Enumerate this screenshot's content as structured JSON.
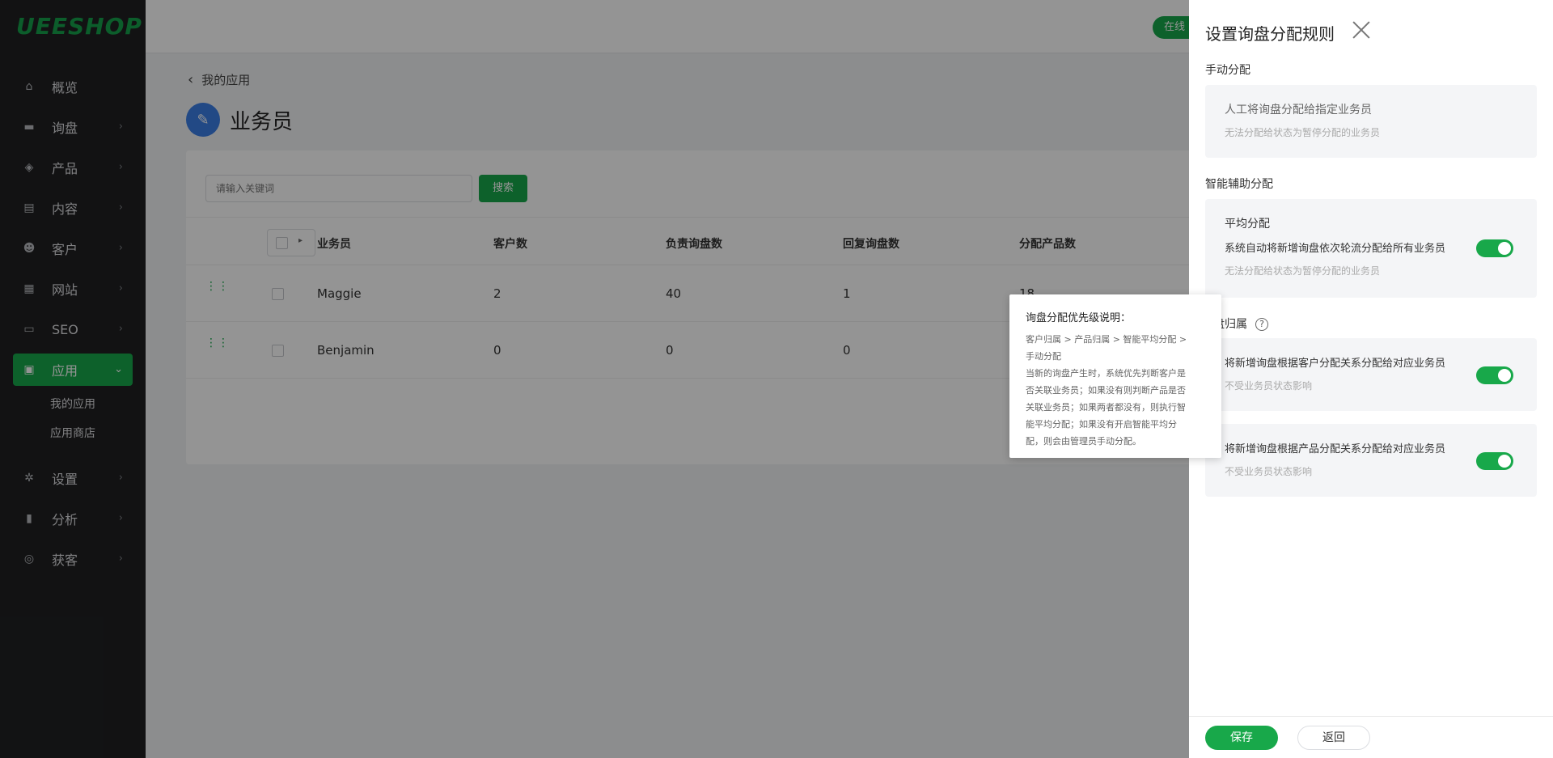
{
  "sidebar": {
    "logo": "UEESHOP",
    "items": [
      {
        "label": "概览",
        "icon": "home-icon"
      },
      {
        "label": "询盘",
        "icon": "inquiry-icon"
      },
      {
        "label": "产品",
        "icon": "product-box-icon"
      },
      {
        "label": "内容",
        "icon": "document-icon"
      },
      {
        "label": "客户",
        "icon": "customers-icon"
      },
      {
        "label": "网站",
        "icon": "store-icon"
      },
      {
        "label": "SEO",
        "icon": "seo-icon"
      },
      {
        "label": "应用",
        "icon": "apps-grid-icon"
      },
      {
        "label": "设置",
        "icon": "gear-icon"
      },
      {
        "label": "分析",
        "icon": "bar-chart-icon"
      },
      {
        "label": "获客",
        "icon": "acquire-icon"
      }
    ],
    "sub_items": [
      "我的应用",
      "应用商店"
    ]
  },
  "topbar": {
    "online_label": "在线"
  },
  "breadcrumb": {
    "back_label": "我的应用"
  },
  "page": {
    "title": "业务员"
  },
  "search": {
    "placeholder": "请输入关键词",
    "button_label": "搜索"
  },
  "table": {
    "columns": [
      "业务员",
      "客户数",
      "负责询盘数",
      "回复询盘数",
      "分配产品数"
    ],
    "rows": [
      {
        "name": "Maggie",
        "customers": "2",
        "inquiries": "40",
        "replied": "1",
        "products": "18"
      },
      {
        "name": "Benjamin",
        "customers": "0",
        "inquiries": "0",
        "replied": "0",
        "products": ""
      }
    ]
  },
  "drawer": {
    "title": "设置询盘分配规则",
    "manual": {
      "section": "手动分配",
      "title": "人工将询盘分配给指定业务员",
      "sub": "无法分配给状态为暂停分配的业务员"
    },
    "smart": {
      "section": "智能辅助分配",
      "title": "平均分配",
      "desc": "系统自动将新增询盘依次轮流分配给所有业务员",
      "sub": "无法分配给状态为暂停分配的业务员",
      "enabled": true
    },
    "ownership": {
      "section_visible": "盘归属",
      "help": "?",
      "customer_rule": {
        "title": "将新增询盘根据客户分配关系分配给对应业务员",
        "sub": "不受业务员状态影响",
        "enabled": true
      },
      "product_rule": {
        "title": "将新增询盘根据产品分配关系分配给对应业务员",
        "sub": "不受业务员状态影响",
        "enabled": true
      }
    },
    "save_label": "保存",
    "back_label": "返回"
  },
  "tooltip": {
    "title": "询盘分配优先级说明：",
    "lines": [
      "客户归属 > 产品归属 > 智能平均分配 >",
      "手动分配",
      "当新的询盘产生时，系统优先判断客户是",
      "否关联业务员；如果没有则判断产品是否",
      "关联业务员；如果两者都没有，则执行智",
      "能平均分配；如果没有开启智能平均分",
      "配，则会由管理员手动分配。"
    ]
  },
  "colors": {
    "brand": "#18a84a",
    "sidebar_bg": "#1f2022",
    "accent_blue": "#3b7ee6"
  }
}
